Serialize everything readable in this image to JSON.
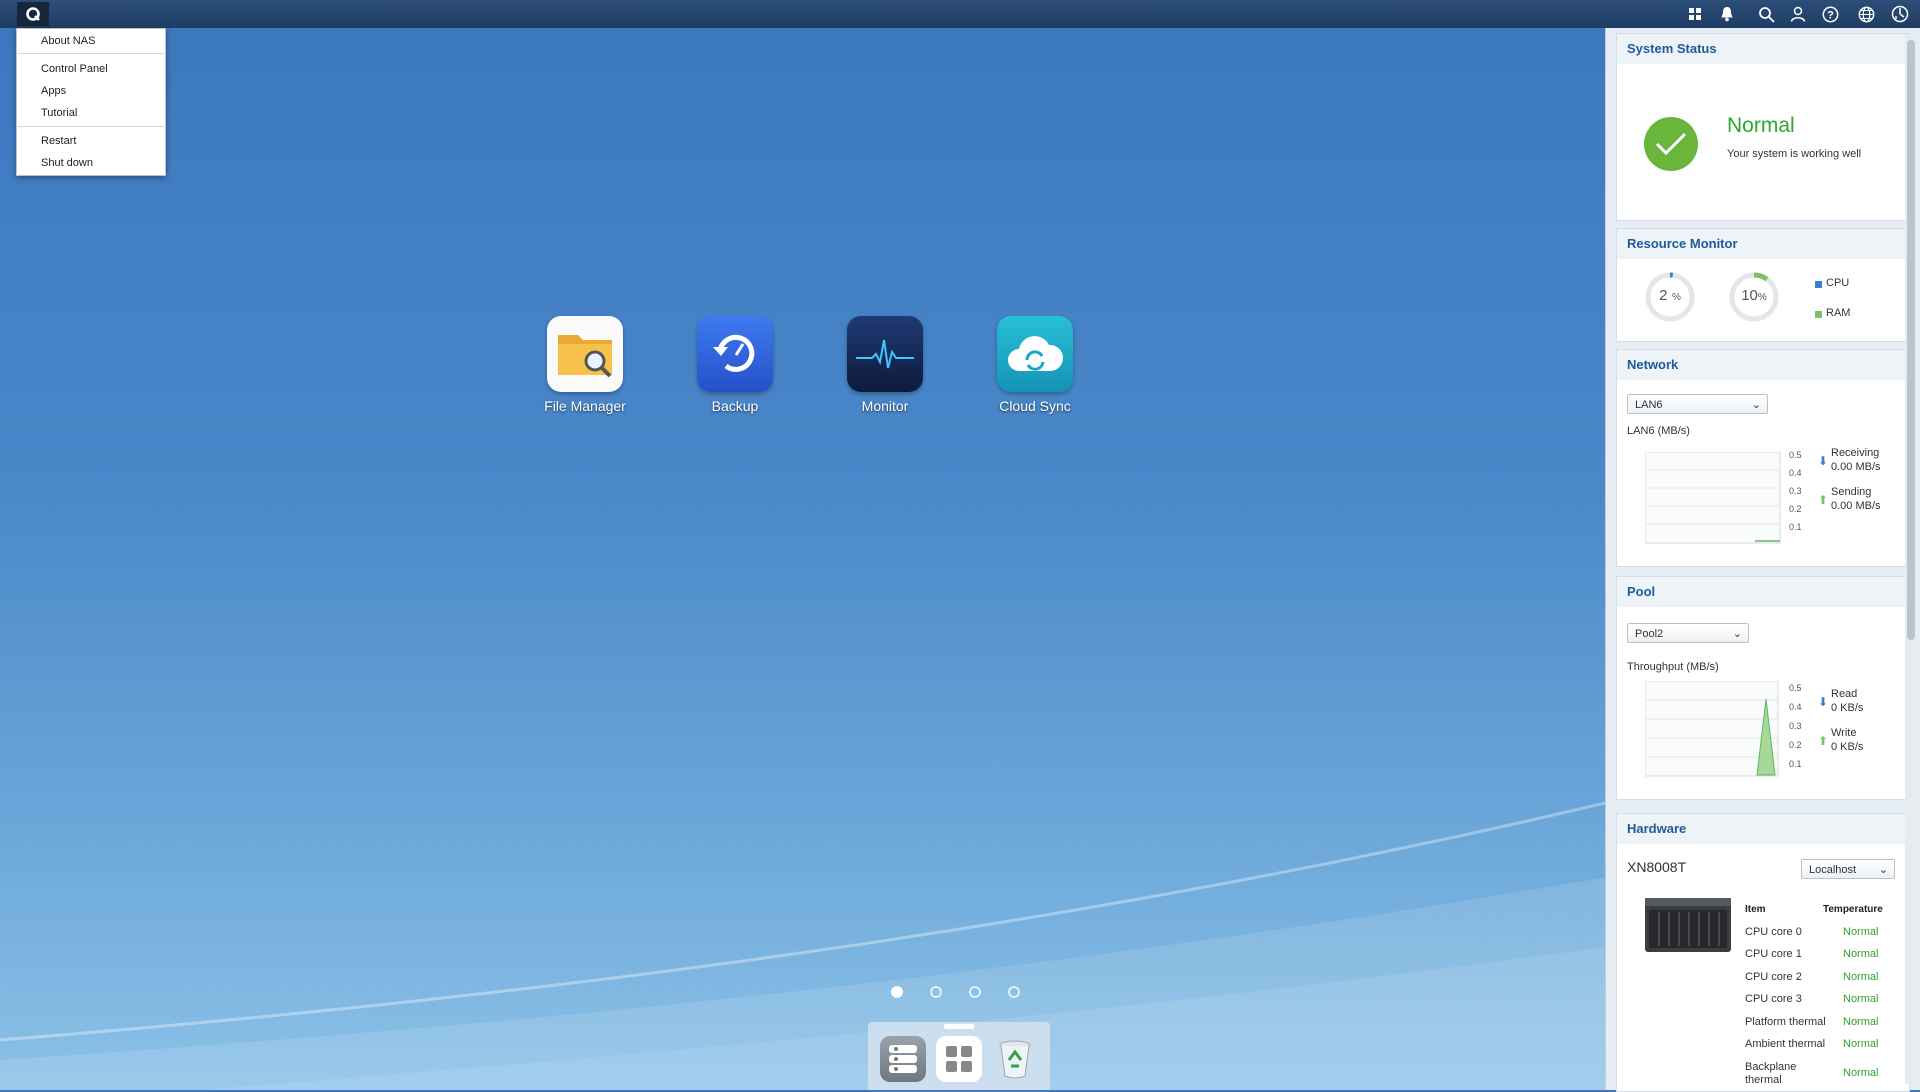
{
  "menu": {
    "items": [
      "About NAS",
      "Control Panel",
      "Apps",
      "Tutorial",
      "Restart",
      "Shut down"
    ]
  },
  "topbar_icons": [
    "apps-icon",
    "bell-icon",
    "search-icon",
    "user-icon",
    "help-icon",
    "globe-icon",
    "dashboard-icon"
  ],
  "desktop": {
    "apps": [
      {
        "label": "File Manager",
        "icon": "file-manager-icon",
        "color": "#f2b540"
      },
      {
        "label": "Backup",
        "icon": "backup-icon",
        "color": "#2d63d8"
      },
      {
        "label": "Monitor",
        "icon": "monitor-icon",
        "color": "#12274f"
      },
      {
        "label": "Cloud Sync",
        "icon": "cloud-sync-icon",
        "color": "#1ea8c8"
      }
    ],
    "page_count": 4,
    "active_page": 1
  },
  "dock": {
    "items": [
      "resource-icon",
      "app-grid-icon",
      "recycle-bin-icon"
    ]
  },
  "status": {
    "title": "System Status",
    "state": "Normal",
    "message": "Your system is working well",
    "color": "#2ea82e"
  },
  "resource": {
    "title": "Resource Monitor",
    "cpu_value": "2",
    "cpu_unit": "%",
    "ram_value": "10",
    "ram_unit": "%",
    "cpu_label": "CPU",
    "ram_label": "RAM",
    "cpu_color": "#3a7fd0",
    "ram_color": "#7ac267"
  },
  "network": {
    "title": "Network",
    "selected": "LAN6",
    "chart_label": "LAN6 (MB/s)",
    "ticks": [
      "0.5",
      "0.4",
      "0.3",
      "0.2",
      "0.1"
    ],
    "receiving_label": "Receiving",
    "receiving_value": "0.00 MB/s",
    "sending_label": "Sending",
    "sending_value": "0.00 MB/s"
  },
  "pool": {
    "title": "Pool",
    "selected": "Pool2",
    "chart_label": "Throughput (MB/s)",
    "ticks": [
      "0.5",
      "0.4",
      "0.3",
      "0.2",
      "0.1"
    ],
    "read_label": "Read",
    "read_value": "0 KB/s",
    "write_label": "Write",
    "write_value": "0 KB/s"
  },
  "hardware": {
    "title": "Hardware",
    "model": "XN8008T",
    "selected": "Localhost",
    "col_item": "Item",
    "col_temp": "Temperature",
    "rows": [
      {
        "item": "CPU core 0",
        "value": "Normal"
      },
      {
        "item": "CPU core 1",
        "value": "Normal"
      },
      {
        "item": "CPU core 2",
        "value": "Normal"
      },
      {
        "item": "CPU core 3",
        "value": "Normal"
      },
      {
        "item": "Platform thermal",
        "value": "Normal"
      },
      {
        "item": "Ambient thermal",
        "value": "Normal"
      },
      {
        "item": "Backplane thermal",
        "value": "Normal"
      }
    ]
  }
}
